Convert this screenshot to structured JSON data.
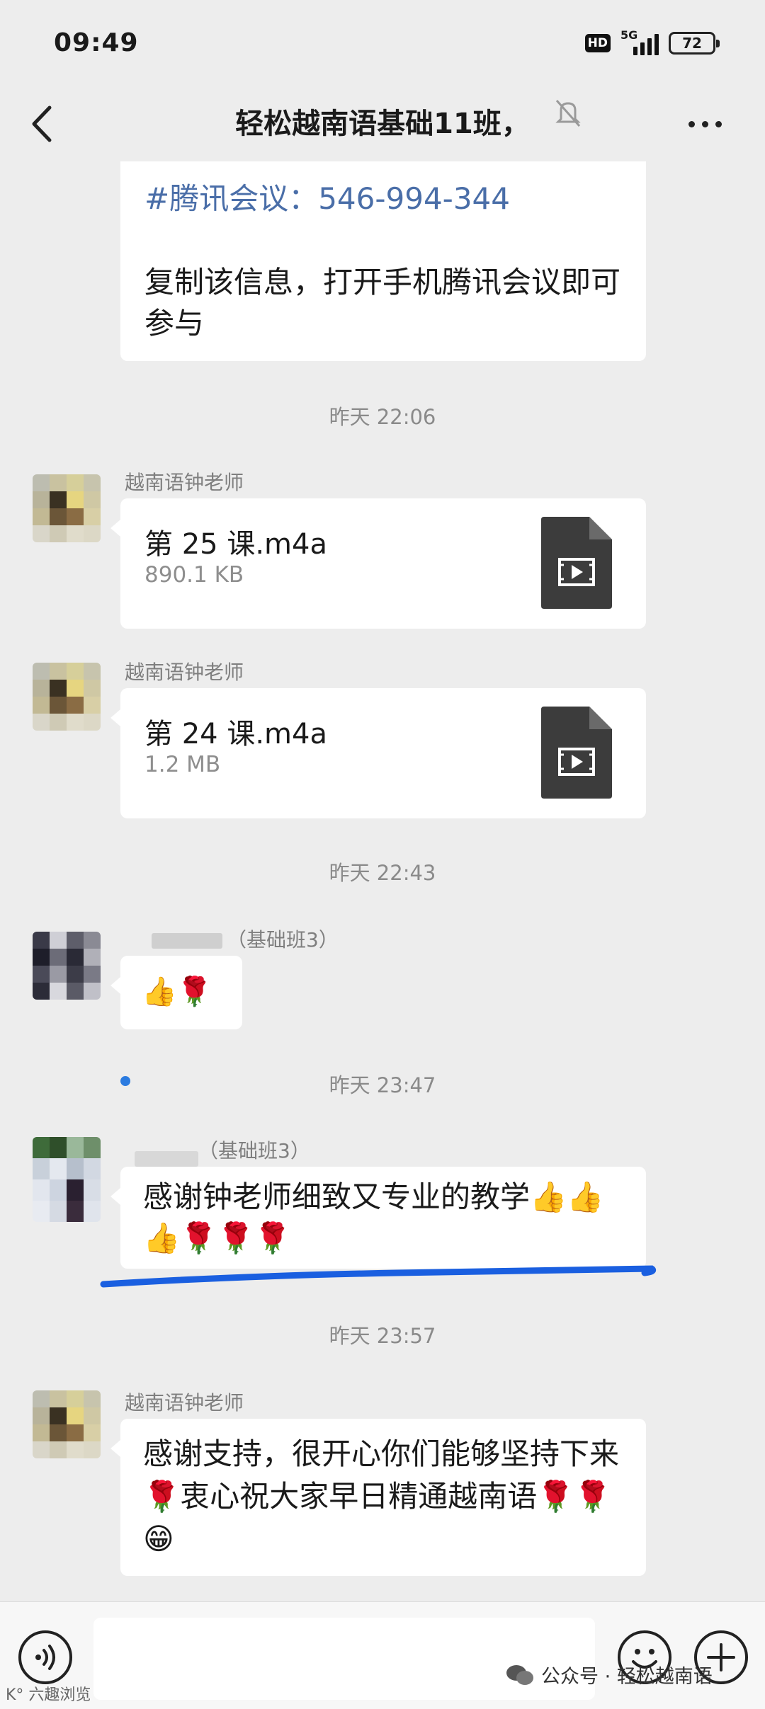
{
  "status_bar": {
    "time": "09:49",
    "hd": "HD",
    "network": "5G",
    "battery": "72"
  },
  "header": {
    "title": "轻松越南语基础11班",
    "title_suffix": "，"
  },
  "messages": {
    "meeting": {
      "line1": "#腾讯会议：546-994-344",
      "line2": "复制该信息，打开手机腾讯会议即可参与"
    },
    "time1": "昨天 22:06",
    "file1": {
      "sender": "越南语钟老师",
      "name": "第 25 课.m4a",
      "size": "890.1 KB"
    },
    "file2": {
      "sender": "越南语钟老师",
      "name": "第 24 课.m4a",
      "size": "1.2 MB"
    },
    "time2": "昨天 22:43",
    "msg3": {
      "sender": "（基础班3）",
      "text": "👍🌹"
    },
    "time3": "昨天 23:47",
    "msg4": {
      "sender": "（基础班3）",
      "text": "感谢钟老师细致又专业的教学👍👍👍🌹🌹🌹"
    },
    "time4": "昨天 23:57",
    "msg5": {
      "sender": "越南语钟老师",
      "text": "感谢支持，很开心你们能够坚持下来🌹衷心祝大家早日精通越南语🌹🌹😁"
    }
  },
  "watermark": {
    "text": "公众号 · 轻松越南语",
    "left_text": "K° 六趣浏览"
  },
  "colors": {
    "background": "#ededed",
    "link": "#4a6ea8",
    "underline": "#1a5fe0"
  },
  "icons": [
    "back-icon",
    "mute-icon",
    "more-icon",
    "video-file-icon",
    "voice-icon",
    "emoji-icon",
    "plus-icon",
    "wechat-icon"
  ]
}
